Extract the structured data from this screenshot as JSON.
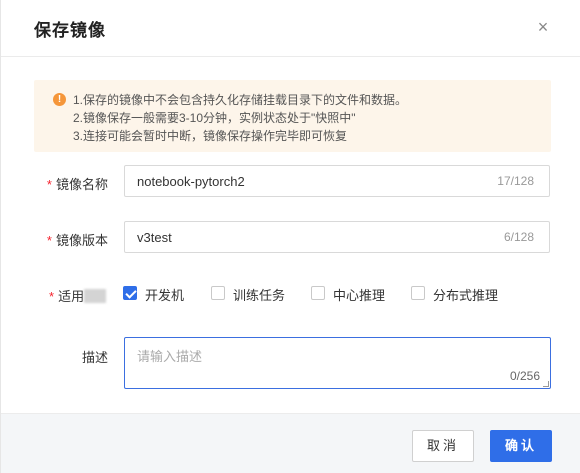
{
  "dialog": {
    "title": "保存镜像",
    "close_glyph": "×"
  },
  "notice": {
    "icon": "warning-icon",
    "icon_glyph": "!",
    "lines": [
      "1.保存的镜像中不会包含持久化存储挂载目录下的文件和数据。",
      "2.镜像保存一般需要3-10分钟，实例状态处于\"快照中\"",
      "3.连接可能会暂时中断，镜像保存操作完毕即可恢复"
    ]
  },
  "form": {
    "required_mark": "*",
    "image_name": {
      "label": "镜像名称",
      "value": "notebook-pytorch2",
      "count": "17/128"
    },
    "image_version": {
      "label": "镜像版本",
      "value": "v3test",
      "count": "6/128"
    },
    "applicable": {
      "label": "适用",
      "options": [
        {
          "label": "开发机",
          "checked": true
        },
        {
          "label": "训练任务",
          "checked": false
        },
        {
          "label": "中心推理",
          "checked": false
        },
        {
          "label": "分布式推理",
          "checked": false
        }
      ]
    },
    "description": {
      "label": "描述",
      "placeholder": "请输入描述",
      "count": "0/256"
    }
  },
  "footer": {
    "cancel_label": "取消",
    "confirm_label": "确认"
  },
  "colors": {
    "primary": "#2f6ee8",
    "notice_bg": "#fdf5ea",
    "warning": "#f5963a",
    "required": "#f5222d"
  }
}
